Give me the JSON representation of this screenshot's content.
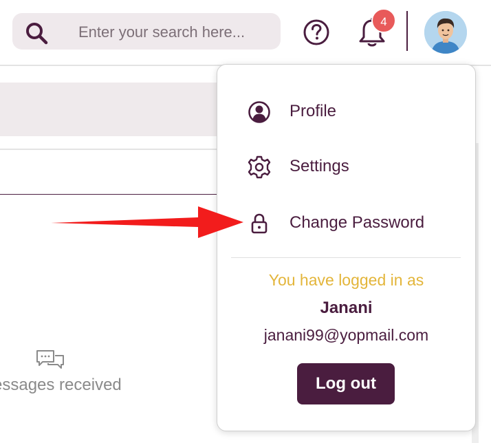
{
  "header": {
    "search": {
      "placeholder": "Enter your search here..."
    },
    "notifications": {
      "count": "4"
    }
  },
  "background": {
    "messages_text": "essages received"
  },
  "dropdown": {
    "items": [
      {
        "label": "Profile",
        "icon": "user-circle-icon"
      },
      {
        "label": "Settings",
        "icon": "gear-icon"
      },
      {
        "label": "Change Password",
        "icon": "lock-icon"
      }
    ],
    "logged_in_text": "You have logged in as",
    "username": "Janani",
    "email": "janani99@yopmail.com",
    "logout_label": "Log out"
  },
  "colors": {
    "brand": "#4a1d3f",
    "accent_text": "#e3b53a",
    "badge": "#e85a5a",
    "arrow": "#f21c1c"
  }
}
